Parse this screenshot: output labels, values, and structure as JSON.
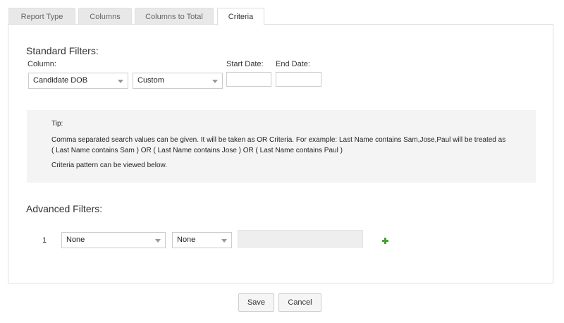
{
  "tabs": [
    {
      "label": "Report Type"
    },
    {
      "label": "Columns"
    },
    {
      "label": "Columns to Total"
    },
    {
      "label": "Criteria"
    }
  ],
  "active_tab": "Criteria",
  "standard_filters": {
    "title": "Standard Filters:",
    "column_label": "Column:",
    "column_value": "Candidate DOB",
    "condition_value": "Custom",
    "start_date_label": "Start Date:",
    "end_date_label": "End Date:",
    "start_date_value": "",
    "end_date_value": ""
  },
  "tip": {
    "heading": "Tip:",
    "line1": "Comma separated search values can be given. It will be taken as OR Criteria. For example: Last Name contains Sam,Jose,Paul will be treated as",
    "line2": "( Last Name contains Sam ) OR ( Last Name contains Jose ) OR ( Last Name contains Paul )",
    "line3": "Criteria pattern can be viewed below."
  },
  "advanced_filters": {
    "title": "Advanced Filters:",
    "rows": [
      {
        "number": "1",
        "column_value": "None",
        "condition_value": "None",
        "value": ""
      }
    ]
  },
  "buttons": {
    "save": "Save",
    "cancel": "Cancel"
  },
  "colors": {
    "plus_icon": "#4aa032",
    "tip_background": "#f4f4f4"
  }
}
